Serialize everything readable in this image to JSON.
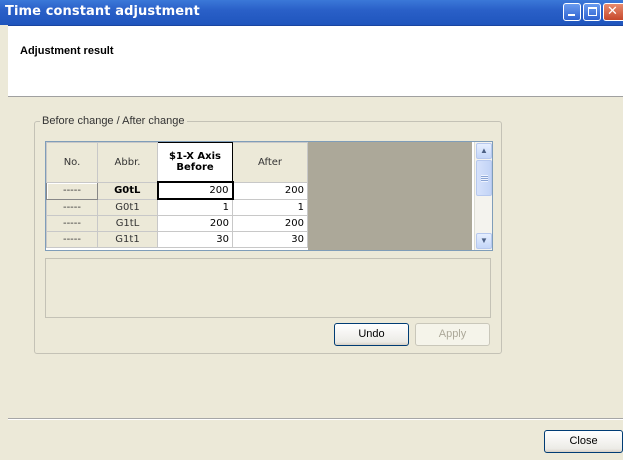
{
  "window": {
    "title": "Time constant adjustment"
  },
  "header": {
    "label": "Adjustment result"
  },
  "group": {
    "label": "Before change / After change"
  },
  "grid": {
    "columns": {
      "no": "No.",
      "abbr": "Abbr.",
      "before": "$1-X Axis\nBefore",
      "before_line1": "$1-X Axis",
      "before_line2": "Before",
      "after": "After"
    },
    "rows": [
      {
        "no": "-----",
        "abbr": "G0tL",
        "before": "200",
        "after": "200"
      },
      {
        "no": "-----",
        "abbr": "G0t1",
        "before": "1",
        "after": "1"
      },
      {
        "no": "-----",
        "abbr": "G1tL",
        "before": "200",
        "after": "200"
      },
      {
        "no": "-----",
        "abbr": "G1t1",
        "before": "30",
        "after": "30"
      }
    ]
  },
  "buttons": {
    "undo": "Undo",
    "apply": "Apply",
    "close": "Close"
  },
  "icons": {
    "minimize": "minimize-icon",
    "maximize": "maximize-icon",
    "close": "close-icon"
  }
}
